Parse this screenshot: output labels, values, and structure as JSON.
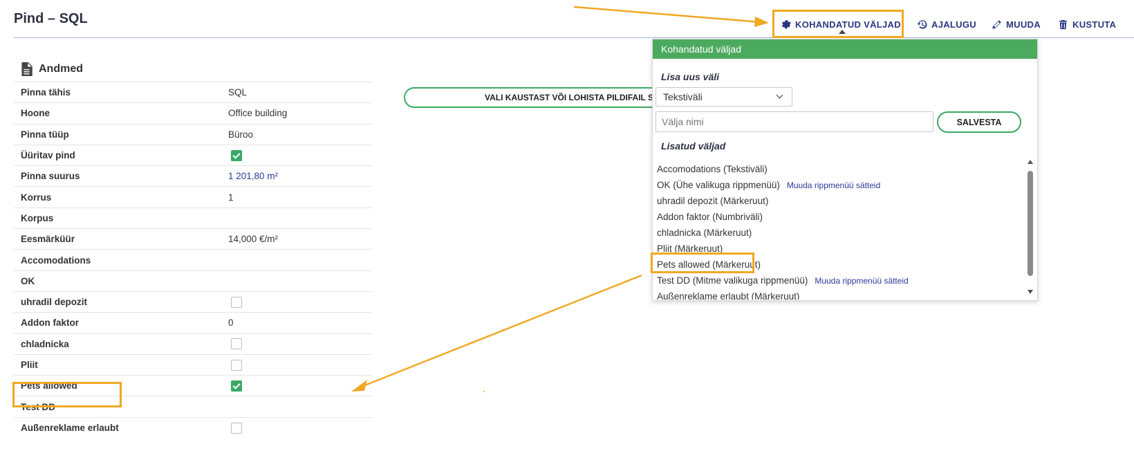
{
  "header": {
    "title": "Pind – SQL",
    "actions": [
      {
        "label": "KOHANDATUD VÄLJAD",
        "icon": "gear-icon"
      },
      {
        "label": "AJALUGU",
        "icon": "history-icon"
      },
      {
        "label": "MUUDA",
        "icon": "pencil-icon"
      },
      {
        "label": "KUSTUTA",
        "icon": "trash-icon"
      }
    ]
  },
  "section": {
    "title": "Andmed",
    "icon": "document-icon"
  },
  "rows": [
    {
      "label": "Pinna tähis",
      "value": "SQL"
    },
    {
      "label": "Hoone",
      "value": "Office building"
    },
    {
      "label": "Pinna tüüp",
      "value": "Büroo"
    },
    {
      "label": "Üüritav pind",
      "checkbox": true
    },
    {
      "label": "Pinna suurus",
      "value": "1 201,80 m²",
      "link": true
    },
    {
      "label": "Korrus",
      "value": "1"
    },
    {
      "label": "Korpus",
      "value": ""
    },
    {
      "label": "Eesmärküür",
      "value": "14,000 €/m²"
    },
    {
      "label": "Accomodations",
      "value": ""
    },
    {
      "label": "OK",
      "value": ""
    },
    {
      "label": "uhradil depozit",
      "checkbox": false
    },
    {
      "label": "Addon faktor",
      "value": "0"
    },
    {
      "label": "chladnicka",
      "checkbox": false
    },
    {
      "label": "Pliit",
      "checkbox": false
    },
    {
      "label": "Pets allowed",
      "checkbox": true
    },
    {
      "label": "Test DD",
      "value": ""
    },
    {
      "label": "Außenreklame erlaubt",
      "checkbox": false
    }
  ],
  "upload": {
    "label": "VALI KAUSTAST VÕI LOHISTA PILDIFAIL SIIA"
  },
  "popup": {
    "title": "Kohandatud väljad",
    "add_heading": "Lisa uus väli",
    "type_select": "Tekstiväli",
    "name_placeholder": "Välja nimi",
    "save_label": "SALVESTA",
    "list_heading": "Lisatud väljad",
    "fields": [
      {
        "label": "Accomodations (Tekstiväli)"
      },
      {
        "label": "OK (Ühe valikuga rippmenüü)",
        "link": "Muuda rippmenüü sätteid"
      },
      {
        "label": "uhradil depozit (Märkeruut)"
      },
      {
        "label": "Addon faktor (Numbriväli)"
      },
      {
        "label": "chladnicka (Märkeruut)"
      },
      {
        "label": "Pliit (Märkeruut)"
      },
      {
        "label": "Pets allowed (Märkeruut)"
      },
      {
        "label": "Test DD (Mitme valikuga rippmenüü)",
        "link": "Muuda rippmenüü sätteid"
      },
      {
        "label": "Außenreklame erlaubt (Märkeruut)"
      }
    ]
  },
  "colors": {
    "accent_green": "#4caa5f",
    "link_blue": "#2a3680",
    "annotation_orange": "#f0a823"
  }
}
